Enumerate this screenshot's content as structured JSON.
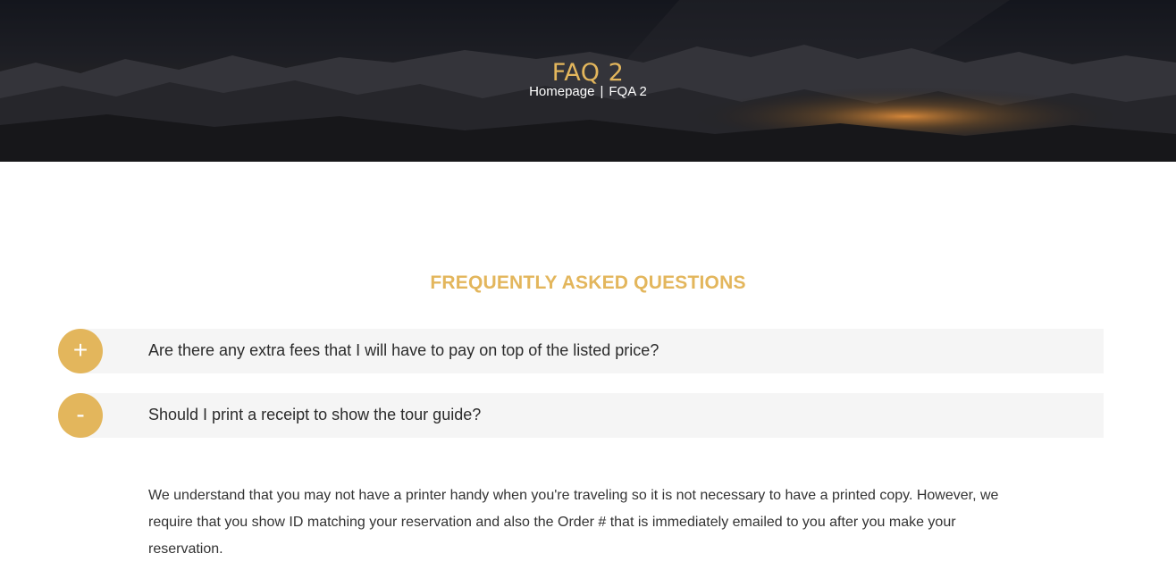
{
  "hero": {
    "title": "FAQ 2",
    "breadcrumb": {
      "home": "Homepage",
      "separator": "|",
      "current": "FQA 2"
    }
  },
  "section": {
    "title": "FREQUENTLY ASKED QUESTIONS"
  },
  "faqs": [
    {
      "toggle": "+",
      "question": "Are there any extra fees that I will have to pay on top of the listed price?",
      "expanded": false
    },
    {
      "toggle": "-",
      "question": "Should I print a receipt to show the tour guide?",
      "expanded": true,
      "answer": "We understand that you may not have a printer handy when you're traveling so it is not necessary to have a printed copy. However, we require that you show ID matching your reservation and also the Order # that is immediately emailed to you after you make your reservation."
    }
  ],
  "colors": {
    "accent": "#e3b65c",
    "bar": "#f5f5f5",
    "text": "#2b2b2b"
  }
}
